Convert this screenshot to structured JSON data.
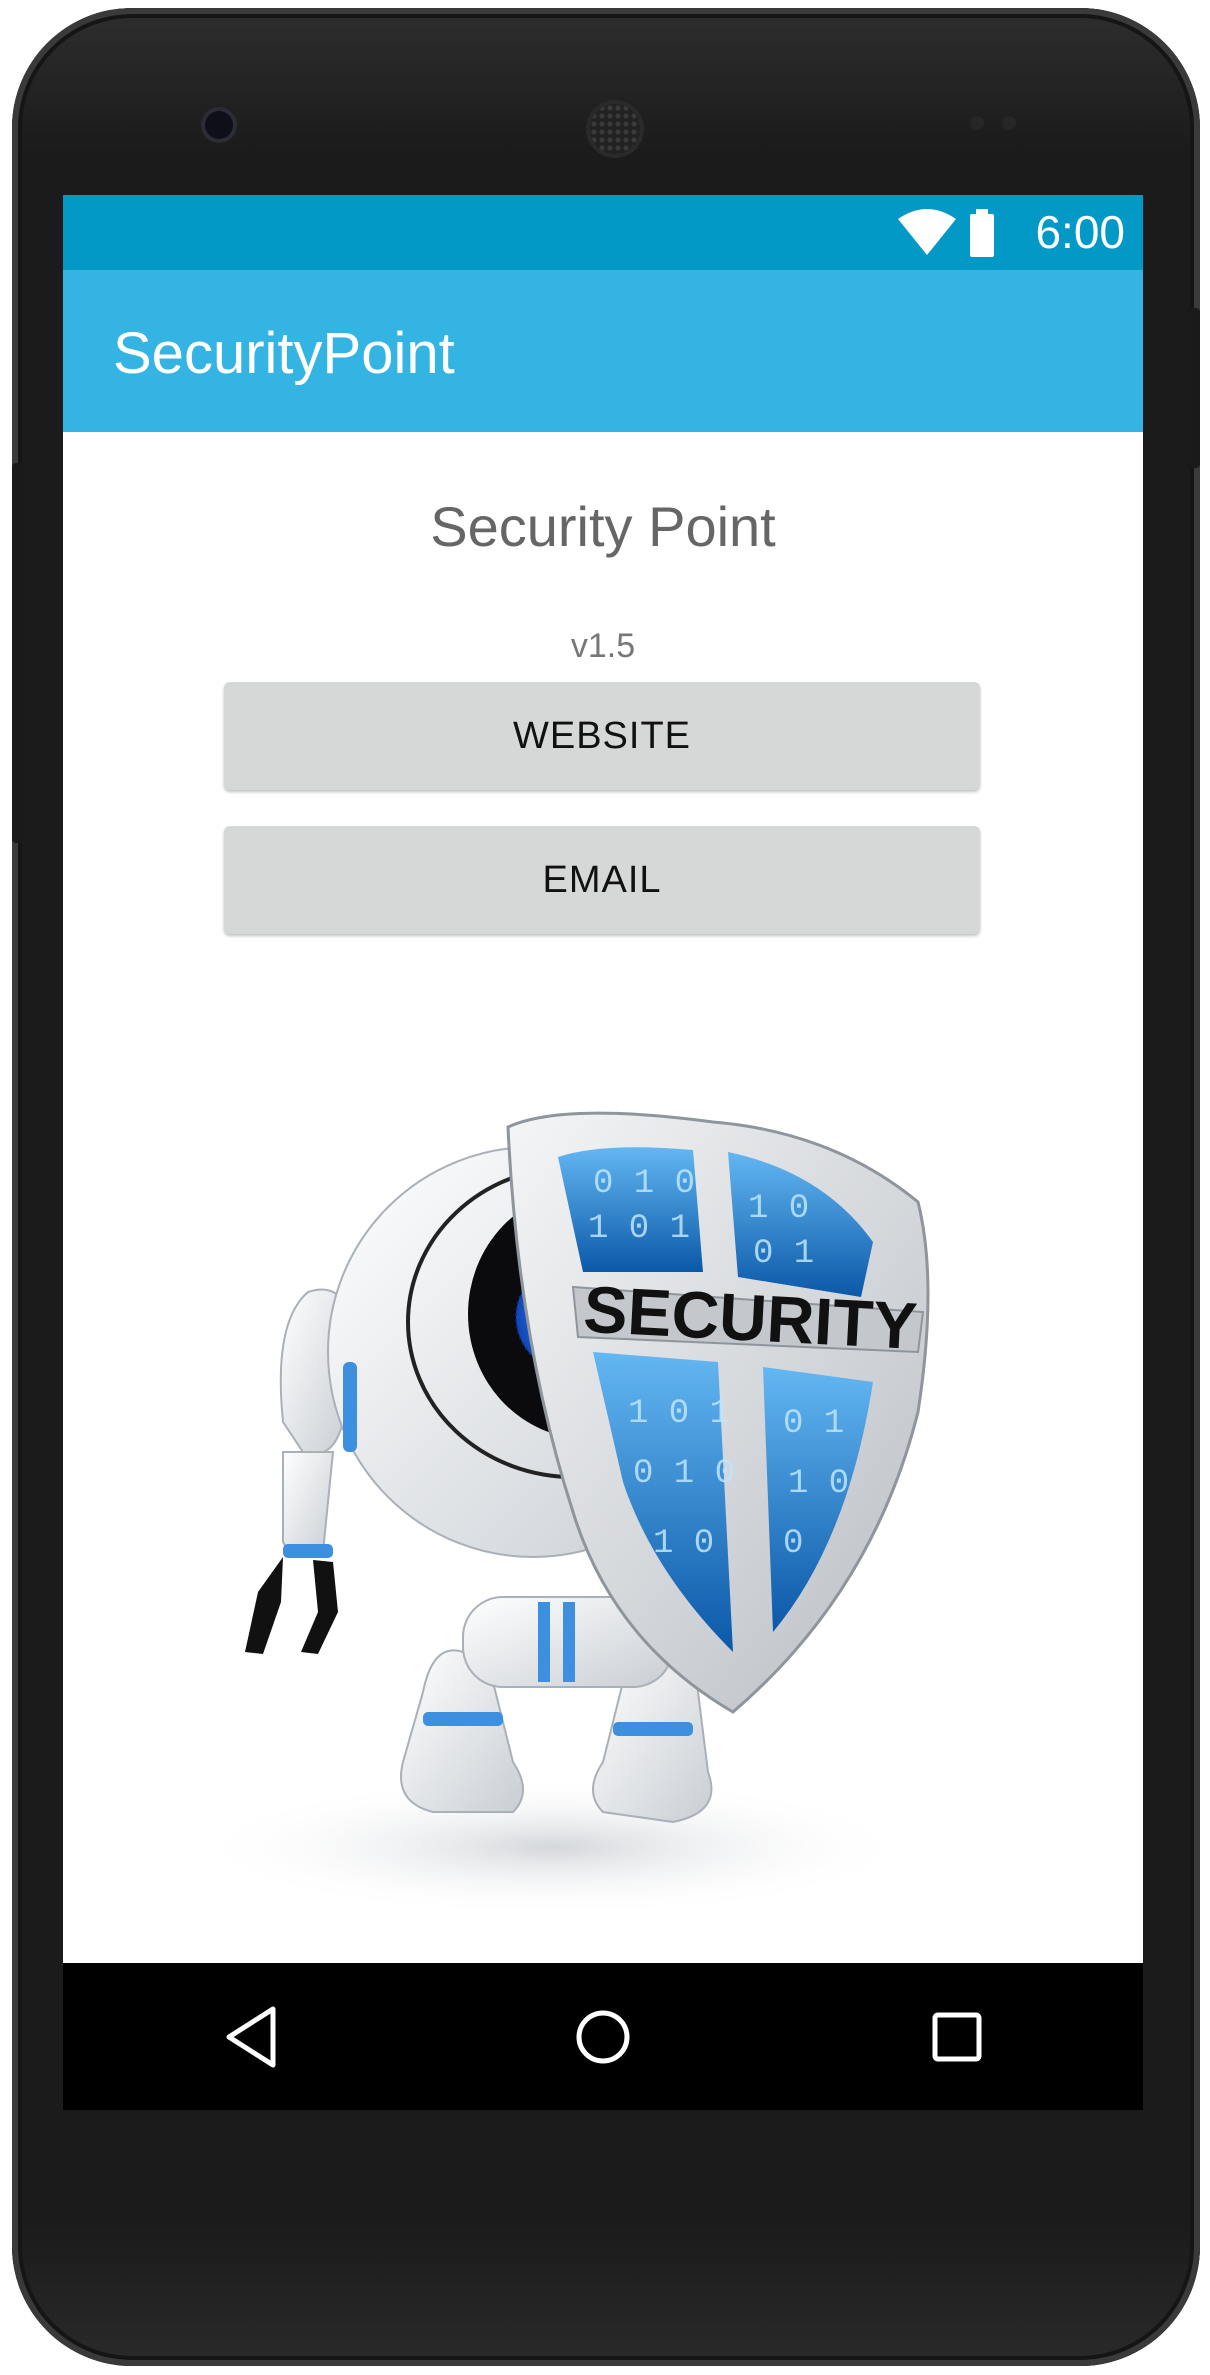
{
  "status_bar": {
    "time": "6:00",
    "icons": [
      "wifi-icon",
      "battery-icon"
    ],
    "color": "#0399c7"
  },
  "app_bar": {
    "title": "SecurityPoint",
    "color": "#33b4e2"
  },
  "main": {
    "headline": "Security Point",
    "version": "v1.5",
    "buttons": [
      {
        "label": "WEBSITE"
      },
      {
        "label": "EMAIL"
      }
    ],
    "illustration": {
      "shield_text": "SECURITY"
    }
  },
  "nav_bar": {
    "icons": [
      "back-icon",
      "home-icon",
      "recent-apps-icon"
    ]
  }
}
